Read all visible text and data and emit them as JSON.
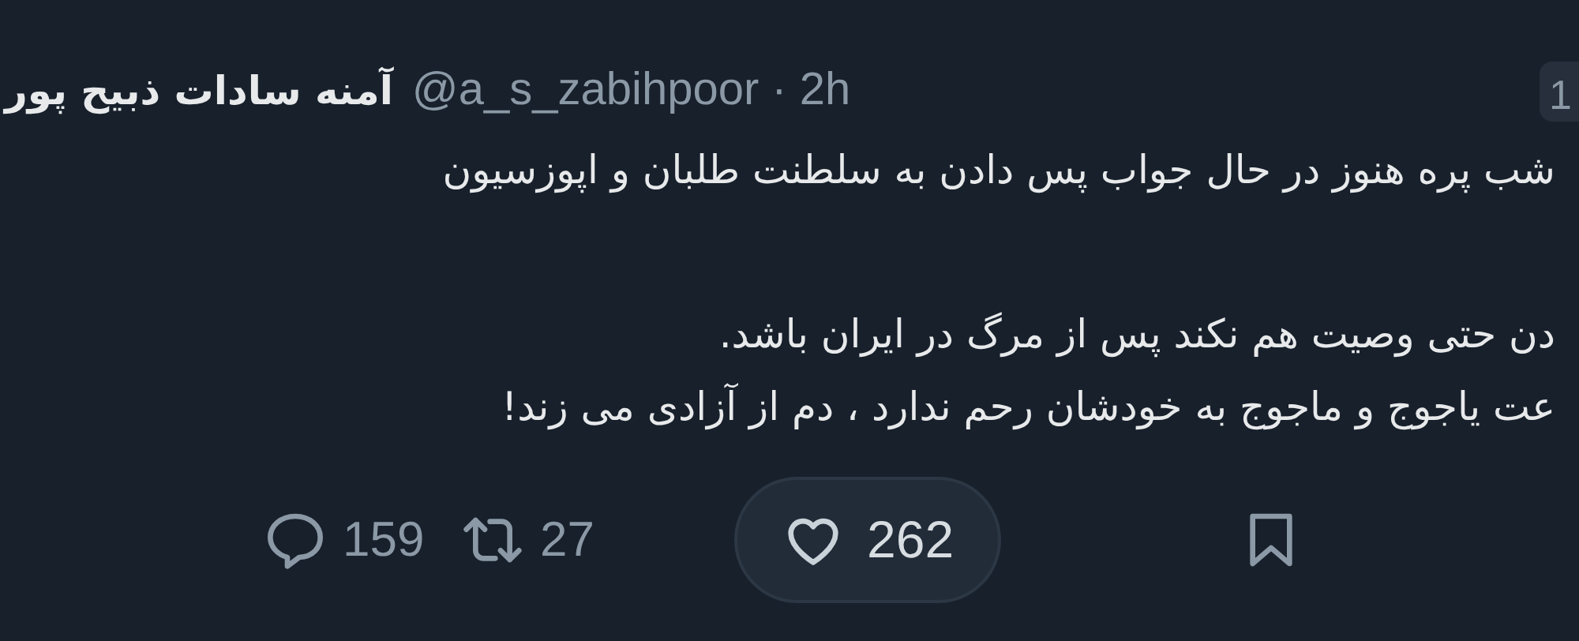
{
  "author": {
    "name": "آمنه سادات ذبیح پور",
    "handle": "@a_s_zabihpoor",
    "separator": "·",
    "time": "2h"
  },
  "corner_badge": "1",
  "text_lines": [
    "شب پره هنوز در حال جواب پس دادن به سلطنت طلبان و اپوزسیون",
    "دن حتی وصیت هم نکند پس از مرگ در ایران باشد.",
    "عت یاجوج و ماجوج به خودشان رحم ندارد ، دم از آزادی می زند!"
  ],
  "actions": [
    {
      "kind": "bookmark",
      "highlighted": false
    },
    {
      "kind": "like",
      "count": "262",
      "highlighted": true
    },
    {
      "kind": "repost",
      "count": "27",
      "highlighted": false
    },
    {
      "kind": "reply",
      "count": "159",
      "highlighted": false
    }
  ]
}
